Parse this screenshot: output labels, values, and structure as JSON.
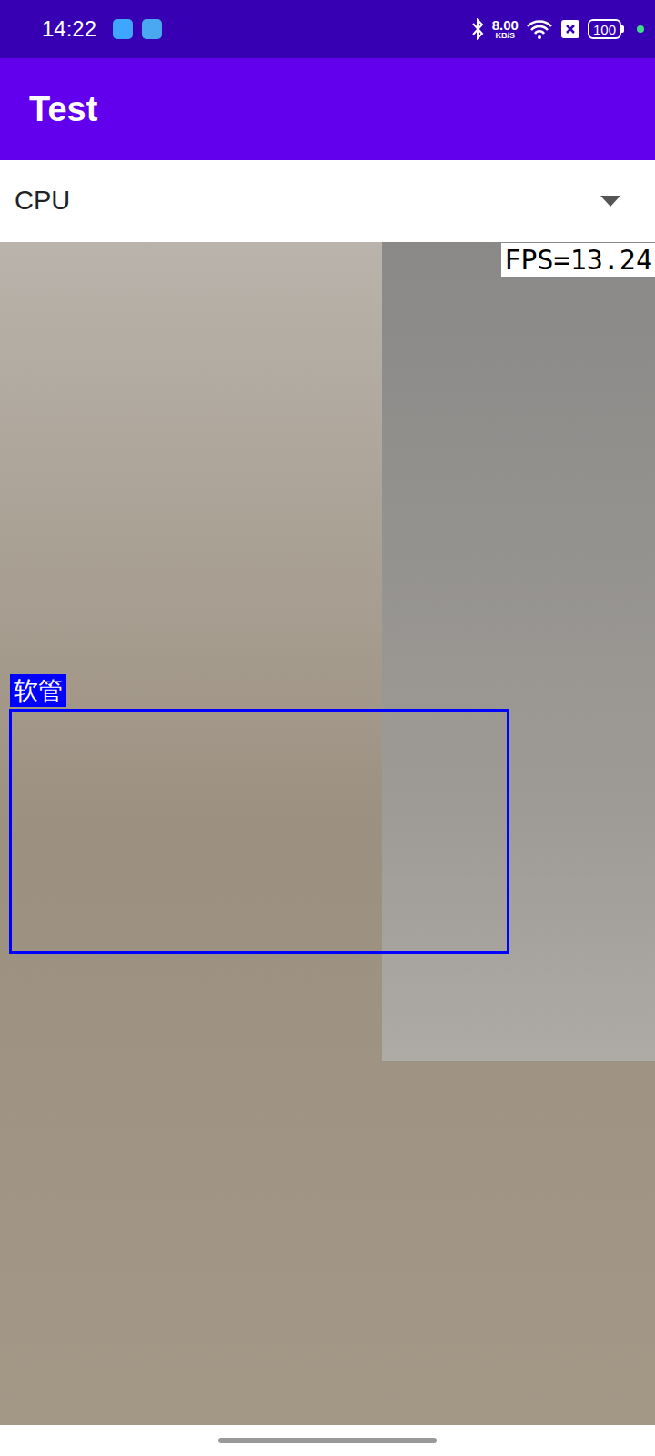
{
  "status_bar": {
    "time": "14:22",
    "net_speed": "8.00",
    "net_unit": "KB/S",
    "battery": "100"
  },
  "app_bar": {
    "title": "Test"
  },
  "device_select": {
    "value": "CPU"
  },
  "preview": {
    "fps": "FPS=13.24",
    "detections": [
      {
        "label": "软管"
      }
    ]
  }
}
